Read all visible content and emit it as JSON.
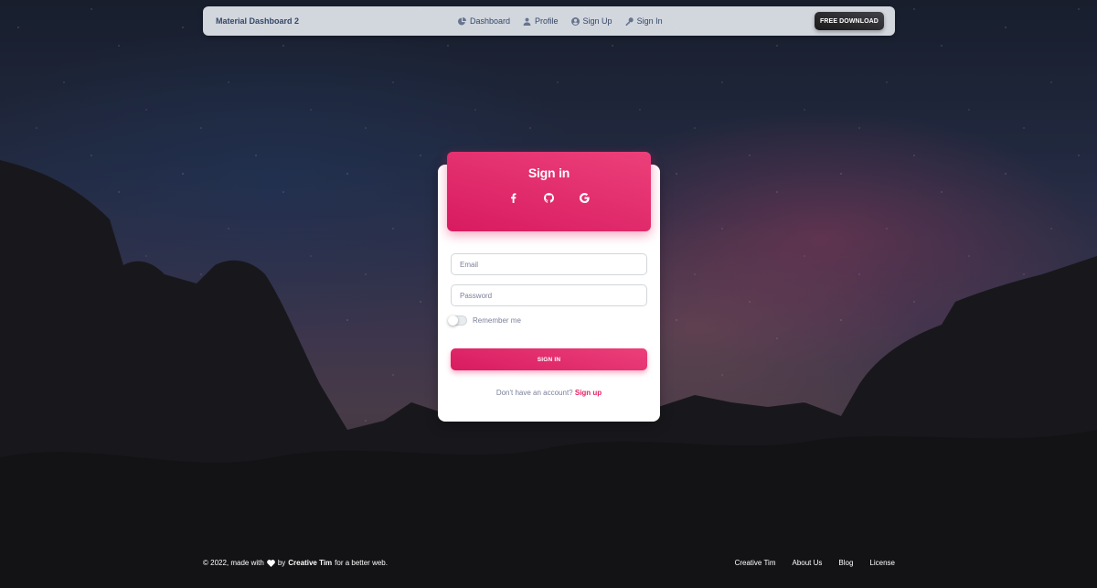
{
  "navbar": {
    "brand": "Material Dashboard 2",
    "links": [
      {
        "label": "Dashboard",
        "icon": "pie-chart-icon"
      },
      {
        "label": "Profile",
        "icon": "user-icon"
      },
      {
        "label": "Sign Up",
        "icon": "user-circle-icon"
      },
      {
        "label": "Sign In",
        "icon": "key-icon"
      }
    ],
    "download_label": "FREE DOWNLOAD"
  },
  "card": {
    "title": "Sign in",
    "social": [
      "facebook-icon",
      "github-icon",
      "google-icon"
    ],
    "email_placeholder": "Email",
    "email_value": "",
    "password_placeholder": "Password",
    "password_value": "",
    "remember_label": "Remember me",
    "remember_checked": false,
    "submit_label": "SIGN IN",
    "signup_prompt": "Don't have an account?",
    "signup_link": "Sign up"
  },
  "footer": {
    "copyright_prefix": "© 2022, made with",
    "by": "by",
    "author": "Creative Tim",
    "suffix": "for a better web.",
    "links": [
      "Creative Tim",
      "About Us",
      "Blog",
      "License"
    ]
  },
  "colors": {
    "accent": "#e91e63",
    "text_dark": "#344767",
    "text_muted": "#7b809a"
  }
}
